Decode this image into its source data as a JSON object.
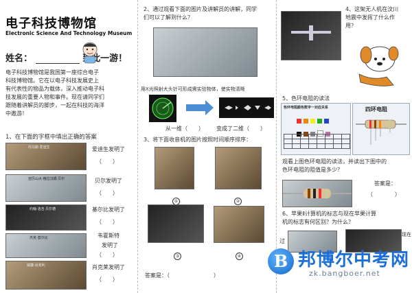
{
  "header": {
    "title": "电子科技博物馆",
    "subtitle": "Electronic Science And Technology Museum",
    "name_label": "姓名：",
    "name_suffix": "到此一游！"
  },
  "intro": {
    "lines": [
      "电子科技博物馆是我国第一座综合电子",
      "科技博物馆。它在以电子科技发展史上",
      "有代表性的物品为载体，深入推动电子科",
      "技发展的重要人物和事件。现在请同学们",
      "跟随着讲解员的脚步，一起在科技的海洋",
      "中遨游！"
    ]
  },
  "q1": {
    "title": "1、在下面的字框中填出正确的答案",
    "scientists": [
      {
        "caption_name": "托马斯·爱迪生",
        "answer_label": "爱迪生发明了",
        "blank": "（　　）"
      },
      {
        "caption_name": "亚历山大·格拉汉姆·贝尔",
        "answer_label": "贝尔发明了",
        "blank": "（　　）"
      },
      {
        "caption_name": "约翰·洛吉·贝尔德",
        "answer_label": "基尔比发明了",
        "blank": "（　　）"
      },
      {
        "caption_name": "杰克·基尔比",
        "answer_label": "韦霍斯特",
        "answer_label2": "发明了",
        "blank": "（　　）"
      },
      {
        "caption_name": "威廉·肖克利",
        "answer_label": "肖克莱发明了",
        "blank": "（　　）"
      }
    ]
  },
  "q2": {
    "title_lines": [
      "2、通过观看下面的图片及讲解员的讲解，同学",
      "们可以了解到什么？"
    ],
    "desc_lines": [
      "用X光照射大头针可形成需实验物体，使实物清晰"
    ],
    "from": "从一维（　　）",
    "to": "变成了二维（　　）"
  },
  "q3": {
    "title": "3、将下面收音机的图片按照时间顺序排序：",
    "nums": [
      "①",
      "②",
      "③",
      "④"
    ],
    "answer": "答案是：（　　　　　　　　）"
  },
  "q4": {
    "lines": [
      "4、这架无人机在汶川",
      "地震中发挥了什么作",
      "用？"
    ]
  },
  "q5": {
    "title": "5、色环电阻的读法",
    "table_title": "色环电阻颜色数字一对应关系",
    "chart_title": "四环电阻",
    "text_lines": [
      "观看上图色环电阻的读法，并读出下图中的",
      "色环电阻的阻值是多少？"
    ],
    "answer": "答案是：",
    "answer_blank": "（　　　　）"
  },
  "q6": {
    "lines": [
      "6、苹果Ⅱ计算机的标志与现在苹果计算",
      "机的标志有何区别？为什么？"
    ],
    "side_left": "过",
    "side_right": "现在"
  },
  "watermark": {
    "logo_letter": "B",
    "brand": "邦博尔中考网",
    "url": "zk.bangboer.net"
  },
  "colors": {
    "accent_blue": "#4a8fd4",
    "watermark_blue": "#1c6fd8",
    "mascot_orange": "#e08a2a"
  }
}
